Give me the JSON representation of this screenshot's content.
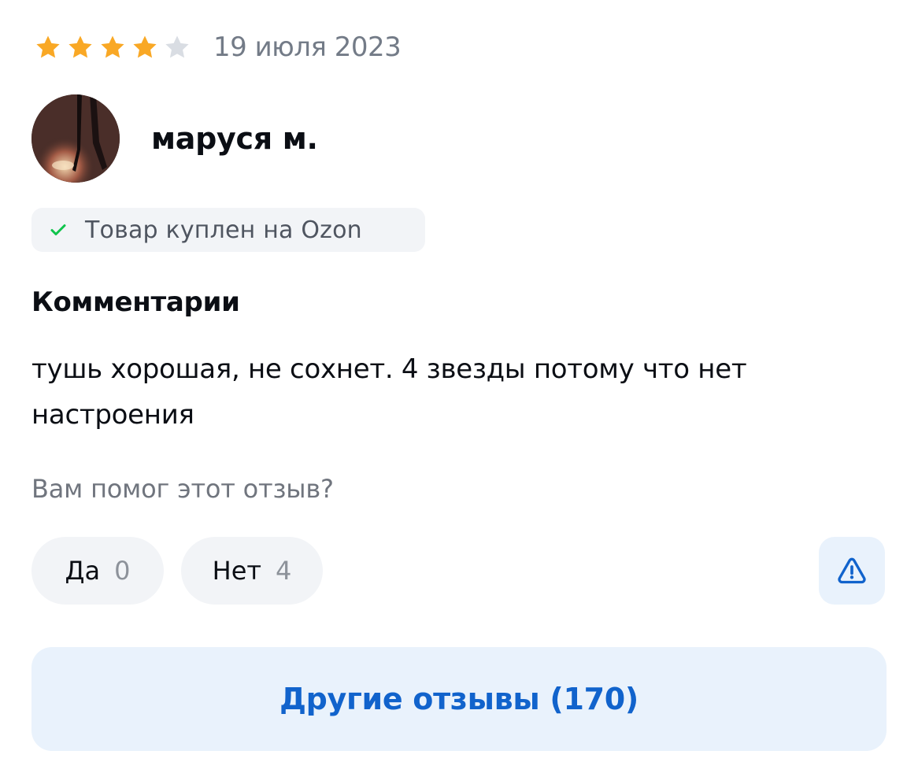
{
  "review": {
    "rating": 4,
    "max_rating": 5,
    "date": "19 июля 2023",
    "author": {
      "name": "маруся м."
    },
    "purchased_badge": "Товар куплен на Ozon",
    "comments_title": "Комментарии",
    "comment_text": "тушь хорошая, не сохнет. 4 звезды потому что нет настроения",
    "helpful_question": "Вам помог этот отзыв?",
    "votes": {
      "yes_label": "Да",
      "yes_count": "0",
      "no_label": "Нет",
      "no_count": "4"
    },
    "report_icon": "warning-triangle-icon",
    "other_reviews_label": "Другие отзывы (170)"
  },
  "colors": {
    "star_filled": "#f9a825",
    "star_empty": "#d9dde3",
    "accent": "#1163cc",
    "button_bg": "#f2f4f7",
    "accent_bg": "#e9f2fc",
    "check_green": "#10c44c"
  }
}
